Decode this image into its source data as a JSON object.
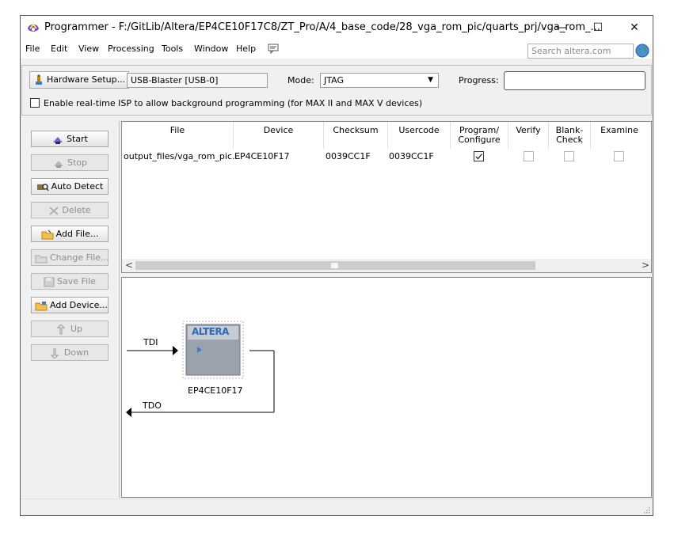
{
  "window": {
    "title": "Programmer - F:/GitLib/Altera/EP4CE10F17C8/ZT_Pro/A/4_base_code/28_vga_rom_pic/quarts_prj/vga_rom_...",
    "controls": {
      "minimize": "—",
      "maximize": "☐",
      "close": "✕"
    }
  },
  "menu": {
    "items": [
      "File",
      "Edit",
      "View",
      "Processing",
      "Tools",
      "Window",
      "Help"
    ],
    "search_placeholder": "Search altera.com"
  },
  "hardware": {
    "setup_button": "Hardware Setup...",
    "device_value": "USB-Blaster [USB-0]",
    "mode_label": "Mode:",
    "mode_value": "JTAG",
    "progress_label": "Progress:",
    "isp_label": "Enable real-time ISP to allow background programming (for MAX II and MAX V devices)",
    "isp_checked": false
  },
  "side_buttons": [
    {
      "label": "Start",
      "enabled": true,
      "icon": "start-icon"
    },
    {
      "label": "Stop",
      "enabled": false,
      "icon": "stop-icon"
    },
    {
      "label": "Auto Detect",
      "enabled": true,
      "icon": "auto-detect-icon"
    },
    {
      "label": "Delete",
      "enabled": false,
      "icon": "delete-icon"
    },
    {
      "label": "Add File...",
      "enabled": true,
      "icon": "add-file-icon"
    },
    {
      "label": "Change File...",
      "enabled": false,
      "icon": "change-file-icon"
    },
    {
      "label": "Save File",
      "enabled": false,
      "icon": "save-file-icon"
    },
    {
      "label": "Add Device...",
      "enabled": true,
      "icon": "add-device-icon"
    },
    {
      "label": "Up",
      "enabled": false,
      "icon": "up-icon"
    },
    {
      "label": "Down",
      "enabled": false,
      "icon": "down-icon"
    }
  ],
  "table": {
    "columns": [
      "File",
      "Device",
      "Checksum",
      "Usercode",
      "Program/\nConfigure",
      "Verify",
      "Blank-\nCheck",
      "Examine"
    ],
    "rows": [
      {
        "file": "output_files/vga_rom_pic...",
        "device": "EP4CE10F17",
        "checksum": "0039CC1F",
        "usercode": "0039CC1F",
        "program": true,
        "verify": false,
        "blank_check": false,
        "examine": false
      }
    ]
  },
  "chain": {
    "tdi": "TDI",
    "tdo": "TDO",
    "device_name": "EP4CE10F17",
    "chip_logo": "ALTERA"
  },
  "colors": {
    "accent": "#1f6fd1",
    "chip_body": "#9aa3ad",
    "border": "#8c8c8c"
  }
}
